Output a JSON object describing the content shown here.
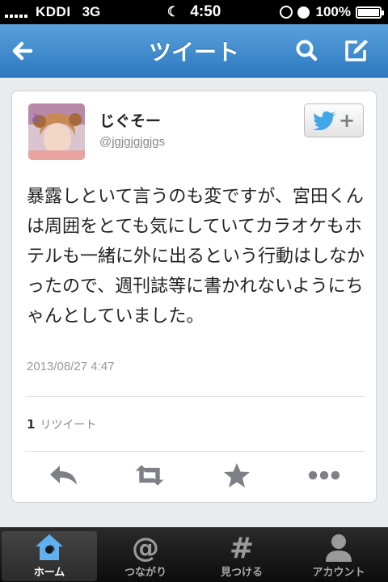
{
  "status_bar": {
    "carrier": "KDDI",
    "network": "3G",
    "time": "4:50",
    "battery": "100%"
  },
  "nav": {
    "title": "ツイート"
  },
  "tweet": {
    "name": "じぐそー",
    "handle": "@jgjgjgjgjgs",
    "text": "暴露しといて言うのも変ですが、宮田くんは周囲をとても気にしていてカラオケもホテルも一緒に外に出るという行動はしなかったので、週刊誌等に書かれないようにちゃんとしていました。",
    "timestamp": "2013/08/27 4:47",
    "retweet_count": "1",
    "retweet_label": "リツイート"
  },
  "tabs": [
    {
      "label": "ホーム",
      "icon": "home-icon",
      "active": true
    },
    {
      "label": "つながり",
      "icon": "at-icon",
      "active": false
    },
    {
      "label": "見つける",
      "icon": "hash-icon",
      "active": false
    },
    {
      "label": "アカウント",
      "icon": "person-icon",
      "active": false
    }
  ],
  "colors": {
    "nav_blue": "#2d78c1",
    "twitter_blue": "#42a7e6",
    "home_blue": "#5fb0ee"
  }
}
